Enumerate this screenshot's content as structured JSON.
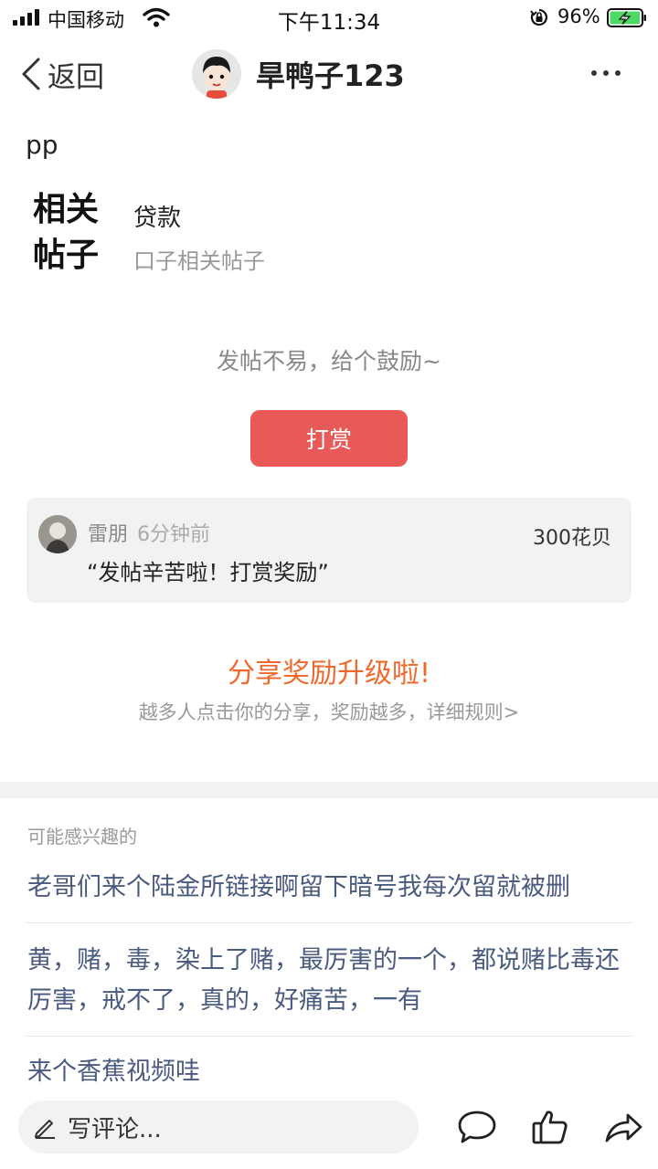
{
  "status_bar": {
    "carrier": "中国移动",
    "time": "下午11:34",
    "battery_percent": "96%",
    "battery_level": 0.96,
    "icons": [
      "signal-icon",
      "wifi-icon",
      "orientation-lock-icon",
      "battery-icon"
    ]
  },
  "nav": {
    "back_label": "返回",
    "title": "旱鸭子123",
    "more_icon": "more-icon"
  },
  "post": {
    "text": "pp",
    "related_title": "相关帖子",
    "related_tag": "贷款",
    "related_subtitle": "口子相关帖子"
  },
  "reward": {
    "encourage_text": "发帖不易，给个鼓励~",
    "button_label": "打赏",
    "button_color": "#e85a57",
    "record": {
      "user_name": "雷朋",
      "time_ago": "6分钟前",
      "amount": "300花贝",
      "message": "“发帖辛苦啦！打赏奖励”"
    }
  },
  "share": {
    "title": "分享奖励升级啦!",
    "subtitle": "越多人点击你的分享，奖励越多，详细规则>",
    "accent_color": "#f0682c"
  },
  "interest": {
    "heading": "可能感兴趣的",
    "items": [
      "老哥们来个陆金所链接啊留下暗号我每次留就被删",
      "黄，赌，毒，染上了赌，最厉害的一个，都说赌比毒还厉害，戒不了，真的，好痛苦，一有",
      "来个香蕉视频哇"
    ],
    "link_color": "#4a5b80"
  },
  "bottom_bar": {
    "comment_placeholder": "写评论...",
    "icons": [
      "comment-icon",
      "like-icon",
      "share-icon"
    ]
  }
}
